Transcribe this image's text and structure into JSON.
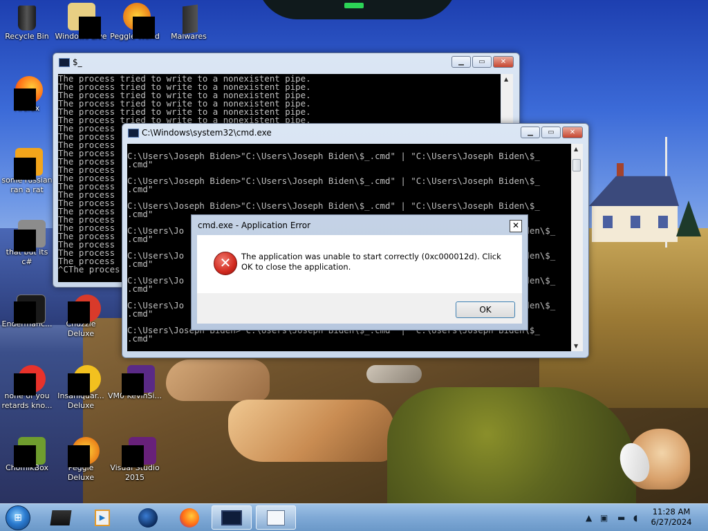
{
  "desktop_icons": [
    {
      "label": "Recycle Bin",
      "icon": "recycle-bin-icon"
    },
    {
      "label": "Windows Live",
      "icon": "windows-live-icon"
    },
    {
      "label": "Peggle World",
      "icon": "peggle-world-icon"
    },
    {
      "label": "Malwares",
      "icon": "folder-icon"
    },
    {
      "label": "Firefox",
      "icon": "firefox-icon"
    },
    {
      "label": "some russian ran a rat",
      "icon": "executable-icon"
    },
    {
      "label": "that but its c#",
      "icon": "shortcut-icon"
    },
    {
      "label": "Endermanc...",
      "icon": "app-icon"
    },
    {
      "label": "Chuzzle Deluxe",
      "icon": "chuzzle-icon"
    },
    {
      "label": "none of you retards kno...",
      "icon": "opera-icon"
    },
    {
      "label": "Insaniquar... Deluxe",
      "icon": "insaniquarium-icon"
    },
    {
      "label": "VM0 KevinSi...",
      "icon": "vm-icon"
    },
    {
      "label": "ChomikBox",
      "icon": "chomikbox-icon"
    },
    {
      "label": "Peggle Deluxe",
      "icon": "peggle-deluxe-icon"
    },
    {
      "label": "Visual Studio 2015",
      "icon": "visual-studio-icon"
    }
  ],
  "back_console": {
    "title": "$_",
    "lines": [
      "The process tried to write to a nonexistent pipe.",
      "The process tried to write to a nonexistent pipe.",
      "The process tried to write to a nonexistent pipe.",
      "The process tried to write to a nonexistent pipe.",
      "The process tried to write to a nonexistent pipe.",
      "The process tried to write to a nonexistent pipe.",
      "The process",
      "The process",
      "The process",
      "The process",
      "The process",
      "The process",
      "The process",
      "The process",
      "The process",
      "The process",
      "The process",
      "The process",
      "The process",
      "The process",
      "The process",
      "The process",
      "The process",
      "^CThe proces"
    ]
  },
  "front_console": {
    "title": "C:\\Windows\\system32\\cmd.exe",
    "lines": [
      "",
      "C:\\Users\\Joseph Biden>\"C:\\Users\\Joseph Biden\\$_.cmd\" | \"C:\\Users\\Joseph Biden\\$_",
      ".cmd\"",
      "",
      "C:\\Users\\Joseph Biden>\"C:\\Users\\Joseph Biden\\$_.cmd\" | \"C:\\Users\\Joseph Biden\\$_",
      ".cmd\"",
      "",
      "C:\\Users\\Joseph Biden>\"C:\\Users\\Joseph Biden\\$_.cmd\" | \"C:\\Users\\Joseph Biden\\$_",
      ".cmd\"",
      "",
      "C:\\Users\\Jo                                                                Biden\\$_",
      ".cmd\"",
      "",
      "C:\\Users\\Jo                                                                Biden\\$_",
      ".cmd\"",
      "",
      "C:\\Users\\Jo                                                                Biden\\$_",
      ".cmd\"",
      "",
      "C:\\Users\\Jo                                                                Biden\\$_",
      ".cmd\"",
      "",
      "C:\\Users\\Joseph Biden>\"C:\\Users\\Joseph Biden\\$_.cmd\" | \"C:\\Users\\Joseph Biden\\$_",
      ".cmd\""
    ]
  },
  "dialog": {
    "title": "cmd.exe - Application Error",
    "close_glyph": "✕",
    "icon": "error-icon",
    "message": "The application was unable to start correctly (0xc000012d). Click OK to close the application.",
    "ok_label": "OK"
  },
  "taskbar": {
    "items": [
      "start-orb",
      "explorer-icon",
      "media-player-icon",
      "globe-icon",
      "firefox-icon",
      "cmd-icon",
      "cmd-window-icon"
    ],
    "clock_time": "11:28 AM",
    "clock_date": "6/27/2024"
  },
  "colors": {
    "console_bg": "#000000",
    "console_text": "#c0c0c0",
    "error_red": "#d12a1f",
    "taskbar": "#7fa9d6"
  }
}
